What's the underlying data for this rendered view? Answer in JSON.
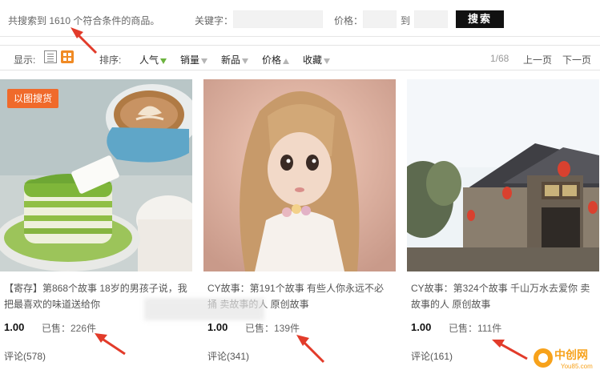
{
  "topbar": {
    "summary": "共搜索到 1610 个符合条件的商品。",
    "keyword_label": "关键字：",
    "price_label": "价格：",
    "to_label": "到",
    "search_button": "搜索"
  },
  "sortbar": {
    "display_label": "显示:",
    "sort_label": "排序:",
    "sort_items": [
      "人气",
      "销量",
      "新品",
      "价格",
      "收藏"
    ],
    "page_count": "1/68",
    "prev_page": "上一页",
    "next_page": "下一页"
  },
  "products": [
    {
      "badge": "以图搜货",
      "title": "【寄存】第868个故事 18岁的男孩子说，我把最喜欢的味道送给你",
      "price": "1.00",
      "sold": "已售：226件",
      "comments": "评论(578)"
    },
    {
      "title": "CY故事：第191个故事 有些人你永远不必捅 卖故事的人 原创故事",
      "price": "1.00",
      "sold": "已售：139件",
      "comments": "评论(341)"
    },
    {
      "title": "CY故事：第324个故事 千山万水去爱你 卖故事的人 原创故事",
      "price": "1.00",
      "sold": "已售：111件",
      "comments": "评论(161)"
    }
  ],
  "watermark": {
    "brand": "中创网",
    "url": "You85.com"
  },
  "colors": {
    "accent_orange": "#f06a2b",
    "search_button_bg": "#111111",
    "arrow_red": "#e23b2a",
    "sort_active_green": "#6cb33f"
  }
}
